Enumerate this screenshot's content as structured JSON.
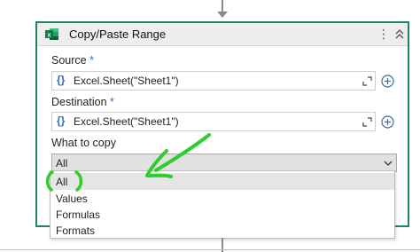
{
  "activity": {
    "title": "Copy/Paste Range",
    "icon": "excel-icon",
    "menu_icon": "kebab-menu-icon",
    "collapse_icon": "chevron-double-up-icon",
    "accent_color": "#20816a"
  },
  "source": {
    "label": "Source",
    "required_mark": "*",
    "value": "Excel.Sheet(\"Sheet1\")",
    "braces": "{}"
  },
  "destination": {
    "label": "Destination",
    "required_mark": "*",
    "value": "Excel.Sheet(\"Sheet1\")",
    "braces": "{}"
  },
  "what_to_copy": {
    "label": "What to copy",
    "selected": "All",
    "options": [
      "All",
      "Values",
      "Formulas",
      "Formats"
    ],
    "highlighted_option": "All"
  },
  "annotation": {
    "color": "#2ecc2e",
    "icon": "hand-drawn-arrow"
  }
}
